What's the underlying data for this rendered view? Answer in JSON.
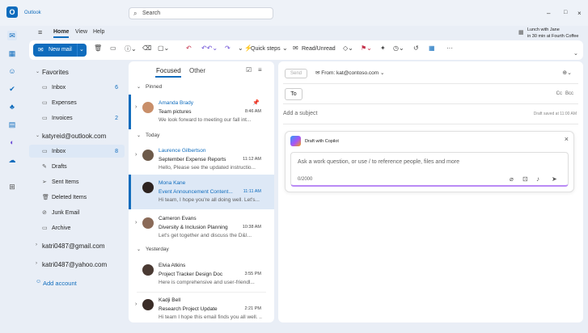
{
  "app": {
    "name": "Outlook"
  },
  "search": {
    "placeholder": "Search"
  },
  "reminder": {
    "title": "Lunch with Jane",
    "detail": "in 30 min at Fourth Coffee"
  },
  "ribbon": {
    "tabs": [
      "Home",
      "View",
      "Help"
    ],
    "new_mail": "New mail",
    "quick_steps": "Quick steps",
    "read_unread": "Read/Unread"
  },
  "folders": {
    "favorites_label": "Favorites",
    "favorites": [
      {
        "label": "Inbox",
        "count": "6"
      },
      {
        "label": "Expenses",
        "count": ""
      },
      {
        "label": "Invoices",
        "count": "2"
      }
    ],
    "account": "katyreid@outlook.com",
    "account_folders": [
      {
        "label": "Inbox",
        "count": "8"
      },
      {
        "label": "Drafts",
        "count": ""
      },
      {
        "label": "Sent Items",
        "count": ""
      },
      {
        "label": "Deleted Items",
        "count": ""
      },
      {
        "label": "Junk Email",
        "count": ""
      },
      {
        "label": "Archive",
        "count": ""
      }
    ],
    "other_accounts": [
      "katri0487@gmail.com",
      "katri0487@yahoo.com"
    ],
    "add_account": "Add account"
  },
  "list": {
    "focused": "Focused",
    "other": "Other",
    "groups": [
      "Pinned",
      "Today",
      "Yesterday"
    ],
    "messages": [
      {
        "name": "Amanda Brady",
        "subject": "Team pictures",
        "time": "8:46 AM",
        "preview": "We look forward to meeting our fall int..."
      },
      {
        "name": "Laurence Gilbertson",
        "subject": "September Expense Reports",
        "time": "11:12 AM",
        "preview": "Hello, Please see the updated instructio..."
      },
      {
        "name": "Mona Kane",
        "subject": "Event Announcement Content...",
        "time": "11:11 AM",
        "preview": "Hi team, I hope you're all doing well. Let's..."
      },
      {
        "name": "Cameron Evans",
        "subject": "Diversity & Inclusion Planning",
        "time": "10:38 AM",
        "preview": "Let's get together and discuss the D&I..."
      },
      {
        "name": "Elvia Atkins",
        "subject": "Project Tracker Design Doc",
        "time": "3:55 PM",
        "preview": "Here is comprehensive and user-friendl..."
      },
      {
        "name": "Kadji Bell",
        "subject": "Research Project Update",
        "time": "2:21 PM",
        "preview": "Hi team I hope this email finds you all well. ..."
      }
    ]
  },
  "compose": {
    "send": "Send",
    "from": "From: kat@contoso.com",
    "to": "To",
    "cc": "Cc",
    "bcc": "Bcc",
    "subject_placeholder": "Add a subject",
    "draft_saved": "Draft saved at 11:00 AM",
    "copilot_title": "Draft with Copilot",
    "copilot_placeholder": "Ask a work question, or use / to reference people, files and more",
    "copilot_count": "0/2000"
  },
  "colors": {
    "accent": "#0f6cbd",
    "background": "#e9eef6",
    "selected": "#dde8f6"
  }
}
